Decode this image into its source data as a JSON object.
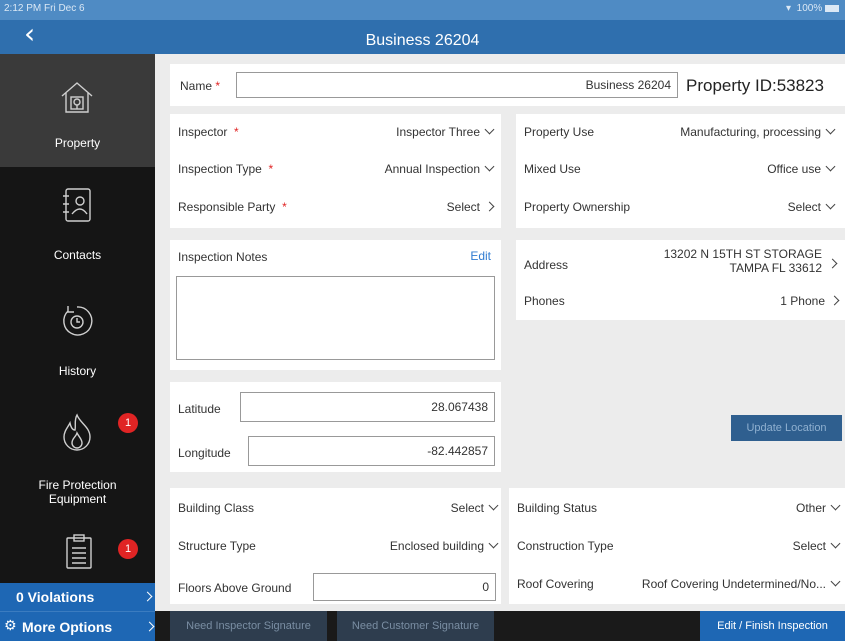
{
  "status": {
    "time": "2:12 PM  Fri Dec 6",
    "battery": " 100%"
  },
  "header": {
    "back": "‹",
    "title": "Business 26204"
  },
  "sidebar": {
    "items": [
      {
        "label": "Property",
        "icon": "house-icon"
      },
      {
        "label": "Contacts",
        "icon": "contacts-icon"
      },
      {
        "label": "History",
        "icon": "history-icon"
      },
      {
        "label": "Fire Protection Equipment",
        "label1": "Fire Protection",
        "label2": "Equipment",
        "icon": "flame-icon",
        "badge": "1"
      },
      {
        "label": "",
        "icon": "clipboard-icon",
        "badge": "1"
      }
    ],
    "violations": "0 Violations",
    "more_options": "More Options"
  },
  "name": {
    "label": "Name",
    "required": "*",
    "value": "Business 26204",
    "property_id": "Property ID:53823"
  },
  "left_fields": [
    {
      "label": "Inspector",
      "required": "*",
      "value": "Inspector Three"
    },
    {
      "label": "Inspection Type",
      "required": "*",
      "value": "Annual Inspection"
    },
    {
      "label": "Responsible Party",
      "required": "*",
      "value": "Select"
    }
  ],
  "right_fields": [
    {
      "label": "Property Use",
      "value": "Manufacturing, processing"
    },
    {
      "label": "Mixed Use",
      "value": "Office use"
    },
    {
      "label": "Property Ownership",
      "value": "Select"
    }
  ],
  "notes": {
    "label": "Inspection Notes",
    "edit": "Edit",
    "value": ""
  },
  "address": {
    "label": "Address",
    "line1": "13202 N 15TH ST STORAGE",
    "line2": "TAMPA FL 33612"
  },
  "phones": {
    "label": "Phones",
    "value": "1 Phone"
  },
  "location": {
    "lat_label": "Latitude",
    "lat_value": "28.067438",
    "lon_label": "Longitude",
    "lon_value": "-82.442857",
    "update_button": "Update Location"
  },
  "building": {
    "left": [
      {
        "label": "Building Class",
        "value": "Select"
      },
      {
        "label": "Structure Type",
        "value": "Enclosed building"
      },
      {
        "label": "Floors Above Ground",
        "value": "0"
      }
    ],
    "right": [
      {
        "label": "Building Status",
        "value": "Other"
      },
      {
        "label": "Construction Type",
        "value": "Select"
      },
      {
        "label": "Roof Covering",
        "value": "Roof Covering Undetermined/No..."
      }
    ]
  },
  "bottom": {
    "inspector_sig": "Need Inspector Signature",
    "customer_sig": "Need Customer Signature",
    "finish": "Edit / Finish Inspection"
  },
  "colors": {
    "header": "#2f6fae",
    "sidebar": "#151515",
    "accent": "#1e67b4",
    "required": "#e02424",
    "badge": "#e02424"
  }
}
